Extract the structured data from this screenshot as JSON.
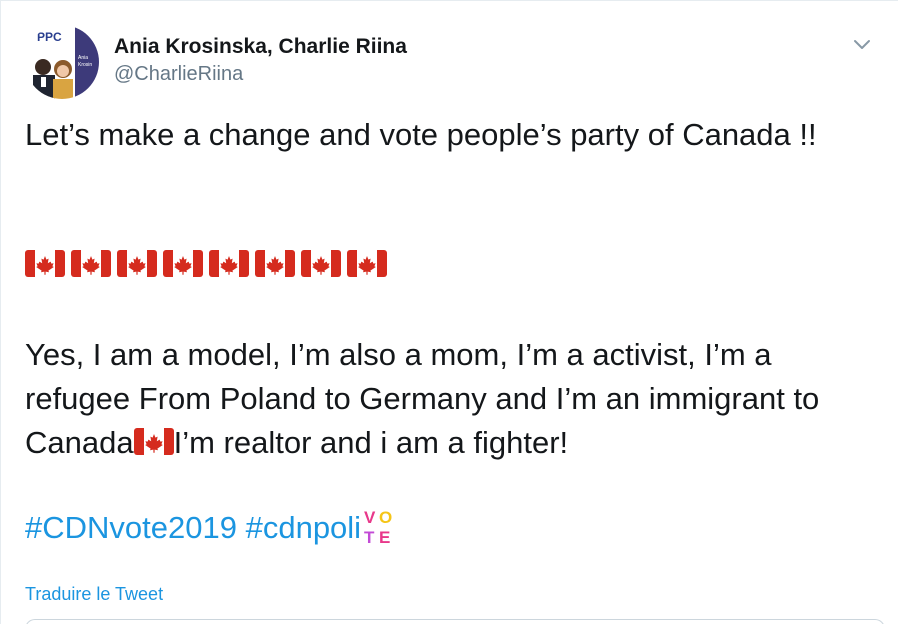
{
  "tweet": {
    "author": {
      "display_name": "Ania Krosinska, Charlie Riina",
      "handle": "@CharlieRiina",
      "avatar_badge": "PPC",
      "avatar_caption": "Ania Krosinsk"
    },
    "text": {
      "paragraph1": "Let’s make a change and vote people’s party of Canada !!",
      "paragraph3_part1": "Yes, I am a model, I’m also a mom, I’m a activist, I’m a refugee From Poland to Germany and I’m an immigrant to Canada",
      "paragraph3_part2": "I’m realtor and i am a fighter!",
      "hashtag1": "#CDNvote2019",
      "hashtag2": "#cdnpoli",
      "flag_count": 8
    },
    "vote_emoji": {
      "letters": [
        "V",
        "O",
        "T",
        "E"
      ],
      "colors": [
        "#e8388a",
        "#f5c518",
        "#c34bd6",
        "#e8388a"
      ]
    },
    "translate_label": "Traduire le Tweet"
  },
  "icons": {
    "menu": "chevron-down-icon",
    "flag": "canada-flag-icon",
    "vote": "vote-emoji-icon"
  },
  "colors": {
    "text": "#14171a",
    "secondary": "#657786",
    "link": "#1b95e0",
    "flag_red": "#d52b1e"
  }
}
